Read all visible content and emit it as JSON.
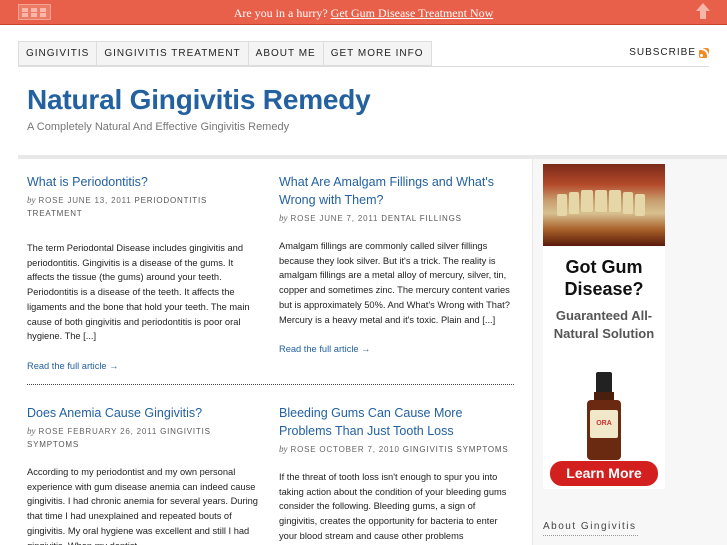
{
  "promo": {
    "text": "Are you in a hurry?",
    "link": "Get Gum Disease Treatment Now",
    "logo_icon": "promo-logo-icon",
    "arrow_icon": "up-arrow-icon"
  },
  "nav": {
    "items": [
      "GINGIVITIS",
      "GINGIVITIS TREATMENT",
      "ABOUT ME",
      "GET MORE INFO"
    ],
    "subscribe": "SUBSCRIBE",
    "rss_icon": "rss-icon"
  },
  "header": {
    "title": "Natural Gingivitis Remedy",
    "description": "A Completely Natural And Effective Gingivitis Remedy"
  },
  "posts": [
    {
      "title": "What is Periodontitis?",
      "by": "by",
      "meta": "ROSE JUNE 13, 2011",
      "category": "PERIODONTITIS TREATMENT",
      "excerpt": "The term Periodontal Disease includes gingivitis and periodontitis. Gingivitis is a disease of the gums. It affects the tissue (the gums) around your teeth. Periodontitis is a disease of the teeth. It affects the ligaments and the bone that hold your teeth. The main cause of both gingivitis and periodontitis is poor oral hygiene. The [...]",
      "read_more": "Read the full article →"
    },
    {
      "title": "What Are Amalgam Fillings and What's Wrong with Them?",
      "by": "by",
      "meta": "ROSE JUNE 7, 2011",
      "category": "DENTAL FILLINGS",
      "excerpt": "Amalgam fillings are commonly called silver fillings because they look silver. But it's a trick. The reality is amalgam fillings are a metal alloy of mercury, silver, tin, copper and sometimes zinc. The mercury content varies but is approximately 50%. And What's Wrong with That? Mercury is a heavy metal and it's toxic. Plain and [...]",
      "read_more": "Read the full article →"
    },
    {
      "title": "Does Anemia Cause Gingivitis?",
      "by": "by",
      "meta": "ROSE FEBRUARY 26, 2011",
      "category": "GINGIVITIS SYMPTOMS",
      "excerpt": "According to my periodontist and my own personal experience with gum disease anemia can indeed cause gingivitis. I had chronic anemia for several years. During that time I had unexplained and repeated bouts of gingivitis. My oral hygiene was excellent and still I had gingivitis. When my dentist"
    },
    {
      "title": "Bleeding Gums Can Cause More Problems Than Just Tooth Loss",
      "by": "by",
      "meta": "ROSE OCTOBER 7, 2010",
      "category": "GINGIVITIS SYMPTOMS",
      "excerpt": "If the threat of tooth loss isn't enough to spur you into taking action about the condition of your bleeding gums consider the following. Bleeding gums, a sign of gingivitis, creates the opportunity for bacteria to enter your blood stream and cause other problems"
    }
  ],
  "sidebar": {
    "ad": {
      "headline": "Got Gum Disease?",
      "subline": "Guaranteed All-Natural Solution",
      "bottle_label": "ORA",
      "button": "Learn More"
    },
    "widget_title": "About Gingivitis"
  }
}
